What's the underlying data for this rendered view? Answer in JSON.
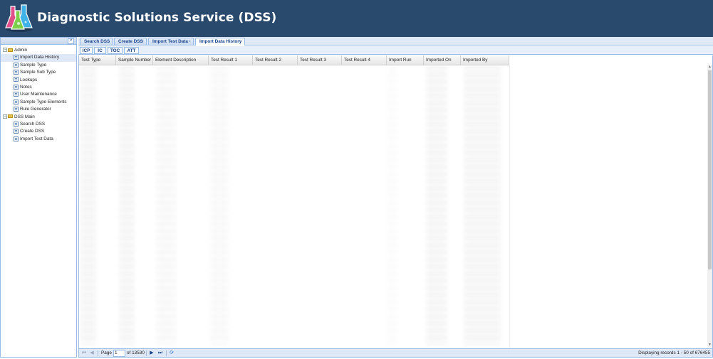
{
  "header": {
    "title": "Diagnostic Solutions Service (DSS)",
    "logo": "flask-logo-icon"
  },
  "sidebar": {
    "collapse_icon": "«",
    "groups": [
      {
        "label": "Admin",
        "expanded": true,
        "items": [
          {
            "label": "Import Data History",
            "selected": true
          },
          {
            "label": "Sample Type"
          },
          {
            "label": "Sample Sub Type"
          },
          {
            "label": "Lookups"
          },
          {
            "label": "Notes"
          },
          {
            "label": "User Maintenance"
          },
          {
            "label": "Sample Type Elements"
          },
          {
            "label": "Rule Generator"
          }
        ]
      },
      {
        "label": "DSS Main",
        "expanded": true,
        "items": [
          {
            "label": "Search DSS"
          },
          {
            "label": "Create DSS"
          },
          {
            "label": "Import Test Data"
          }
        ]
      }
    ]
  },
  "tabs": [
    {
      "label": "Search DSS"
    },
    {
      "label": "Create DSS"
    },
    {
      "label": "Import Test Data"
    },
    {
      "label": "Import Data History",
      "active": true
    }
  ],
  "subtabs": [
    {
      "label": "ICP",
      "active": true
    },
    {
      "label": "IC"
    },
    {
      "label": "TOC"
    },
    {
      "label": "ATT"
    }
  ],
  "grid": {
    "columns": [
      "Test Type",
      "Sample Number",
      "Element Description",
      "Test Result 1",
      "Test Result 2",
      "Test Result 3",
      "Test Result 4",
      "Import Run",
      "Imported On",
      "Imported By"
    ]
  },
  "pager": {
    "page_label": "Page",
    "page_value": "1",
    "of_label": "of 13530",
    "status": "Displaying records 1 - 50 of 676455"
  }
}
